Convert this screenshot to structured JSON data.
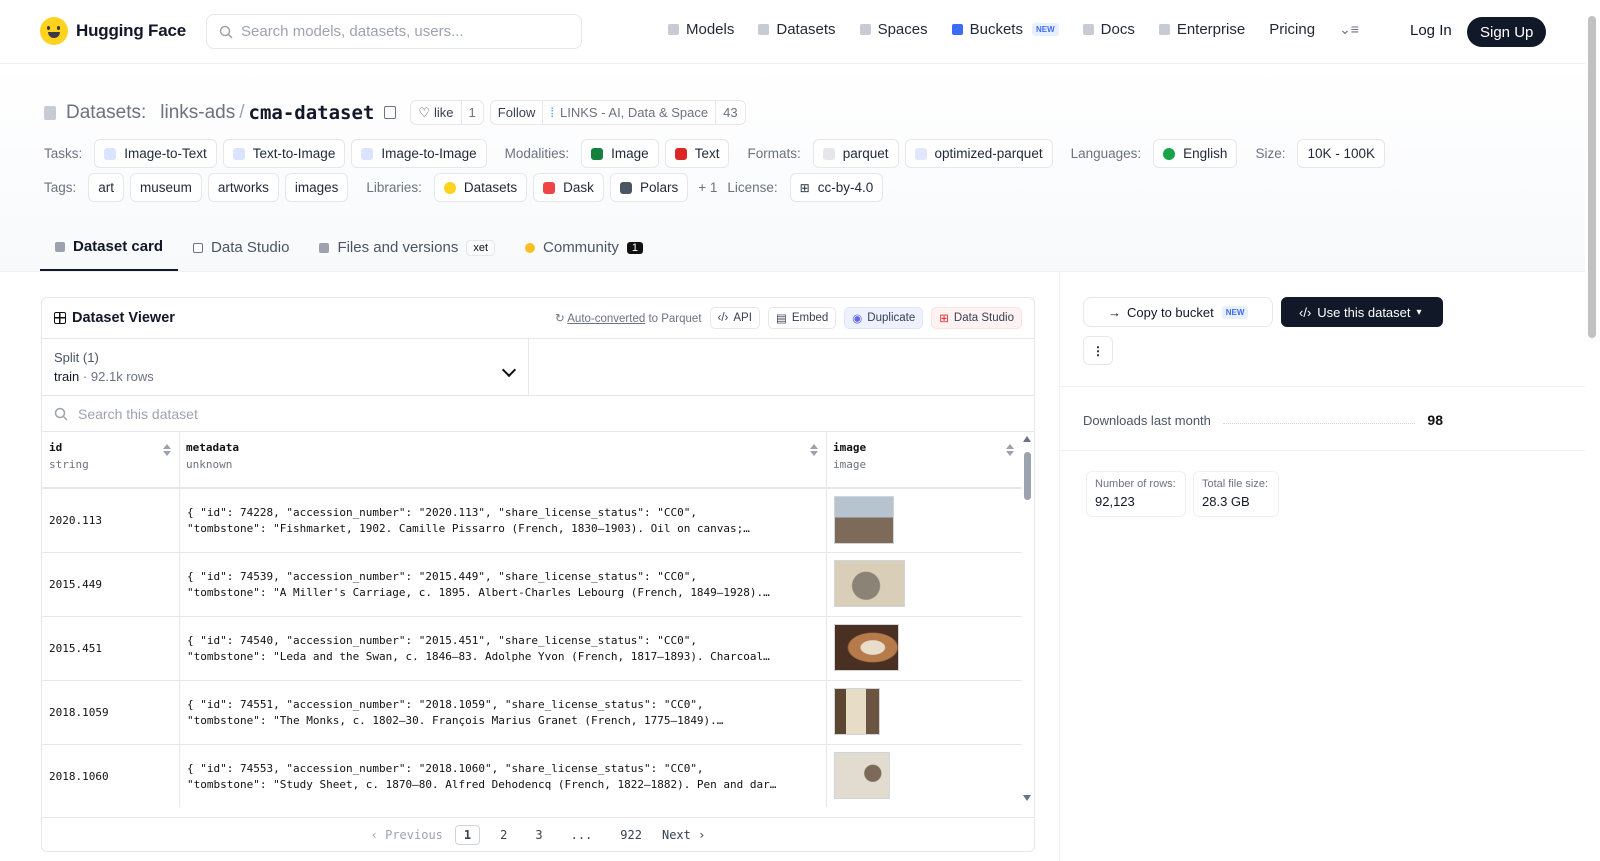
{
  "nav": {
    "brand": "Hugging Face",
    "search_placeholder": "Search models, datasets, users...",
    "links": [
      {
        "label": "Models",
        "icon": "cube-icon"
      },
      {
        "label": "Datasets",
        "icon": "database-icon"
      },
      {
        "label": "Spaces",
        "icon": "grid-icon"
      },
      {
        "label": "Buckets",
        "icon": "bucket-icon",
        "badge": "NEW"
      },
      {
        "label": "Docs",
        "icon": "book-icon"
      },
      {
        "label": "Enterprise",
        "icon": "enterprise-icon"
      },
      {
        "label": "Pricing"
      }
    ],
    "login": "Log In",
    "signup": "Sign Up"
  },
  "header": {
    "section": "Datasets:",
    "org": "links-ads",
    "sep": "/",
    "name": "cma-dataset",
    "like_label": "like",
    "like_count": "1",
    "follow_label": "Follow",
    "follow_org": "LINKS - AI, Data & Space",
    "follow_count": "43"
  },
  "meta": {
    "tasks_label": "Tasks:",
    "tasks": [
      "Image-to-Text",
      "Text-to-Image",
      "Image-to-Image"
    ],
    "modalities_label": "Modalities:",
    "modalities": [
      "Image",
      "Text"
    ],
    "formats_label": "Formats:",
    "formats": [
      "parquet",
      "optimized-parquet"
    ],
    "languages_label": "Languages:",
    "languages": [
      "English"
    ],
    "size_label": "Size:",
    "size": "10K - 100K",
    "tags_label": "Tags:",
    "tags": [
      "art",
      "museum",
      "artworks",
      "images"
    ],
    "libraries_label": "Libraries:",
    "libraries": [
      "Datasets",
      "Dask",
      "Polars"
    ],
    "libraries_more": "+ 1",
    "license_label": "License:",
    "license": "cc-by-4.0"
  },
  "tabs": [
    {
      "label": "Dataset card",
      "active": true
    },
    {
      "label": "Data Studio"
    },
    {
      "label": "Files and versions",
      "badge": "xet"
    },
    {
      "label": "Community",
      "count": "1"
    }
  ],
  "viewer": {
    "title": "Dataset Viewer",
    "auto_converted": "Auto-converted",
    "to_parquet": "to Parquet",
    "api": "API",
    "embed": "Embed",
    "duplicate": "Duplicate",
    "data_studio": "Data Studio",
    "split_label": "Split (1)",
    "split_name": "train",
    "split_dot": "·",
    "split_rows": "92.1k rows",
    "search_placeholder": "Search this dataset",
    "columns": [
      {
        "name": "id",
        "type": "string"
      },
      {
        "name": "metadata",
        "type": "unknown"
      },
      {
        "name": "image",
        "type": "image"
      }
    ],
    "rows": [
      {
        "id": "2020.113",
        "line1": "{ \"id\": 74228, \"accession_number\": \"2020.113\", \"share_license_status\": \"CC0\",",
        "line2": "\"tombstone\": \"Fishmarket, 1902. Camille Pissarro (French, 1830–1903). Oil on canvas;…",
        "thumb_color": "#8a9aa8"
      },
      {
        "id": "2015.449",
        "line1": "{ \"id\": 74539, \"accession_number\": \"2015.449\", \"share_license_status\": \"CC0\",",
        "line2": "\"tombstone\": \"A Miller's Carriage, c. 1895. Albert-Charles Lebourg (French, 1849–1928).…",
        "thumb_color": "#c9bda6"
      },
      {
        "id": "2015.451",
        "line1": "{ \"id\": 74540, \"accession_number\": \"2015.451\", \"share_license_status\": \"CC0\",",
        "line2": "\"tombstone\": \"Leda and the Swan, c. 1846–83. Adolphe Yvon (French, 1817–1893). Charcoal…",
        "thumb_color": "#6b4a36"
      },
      {
        "id": "2018.1059",
        "line1": "{ \"id\": 74551, \"accession_number\": \"2018.1059\", \"share_license_status\": \"CC0\",",
        "line2": "\"tombstone\": \"The Monks, c. 1802–30. François Marius Granet (French, 1775–1849).…",
        "thumb_color": "#8c7456"
      },
      {
        "id": "2018.1060",
        "line1": "{ \"id\": 74553, \"accession_number\": \"2018.1060\", \"share_license_status\": \"CC0\",",
        "line2": "\"tombstone\": \"Study Sheet, c. 1870–80. Alfred Dehodencq (French, 1822–1882). Pen and dar…",
        "thumb_color": "#d8d2c6"
      }
    ],
    "pager": {
      "prev": "‹ Previous",
      "pages": [
        "1",
        "2",
        "3",
        "...",
        "922"
      ],
      "next": "Next ›",
      "current": "1"
    }
  },
  "sidebar": {
    "copy_bucket": "Copy to bucket",
    "copy_badge": "NEW",
    "use_dataset": "Use this dataset",
    "more": "⋮",
    "downloads_label": "Downloads last month",
    "downloads": "98",
    "rows_label": "Number of rows:",
    "rows_value": "92,123",
    "size_label": "Total file size:",
    "size_value": "28.3 GB"
  }
}
